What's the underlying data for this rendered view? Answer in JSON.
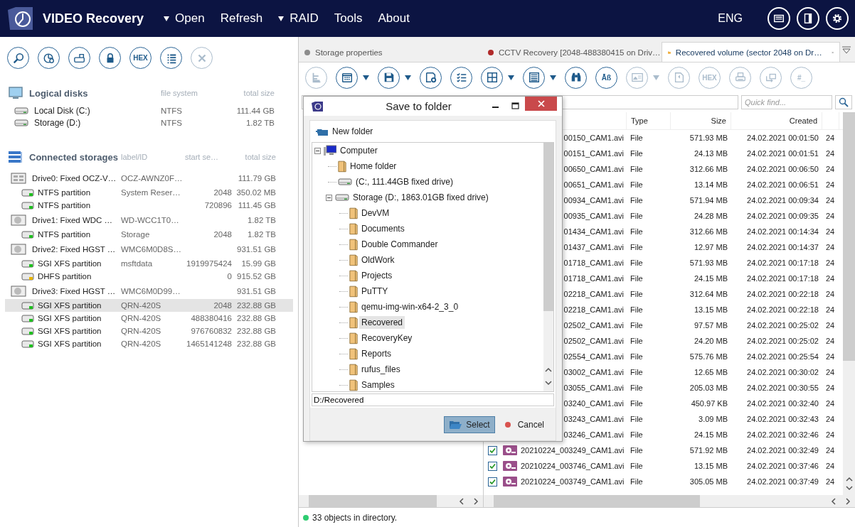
{
  "app": {
    "title": "VIDEO Recovery"
  },
  "menu": [
    {
      "label": "Open",
      "dropdown": true
    },
    {
      "label": "Refresh",
      "dropdown": false
    },
    {
      "label": "RAID",
      "dropdown": true
    },
    {
      "label": "Tools",
      "dropdown": false
    },
    {
      "label": "About",
      "dropdown": false
    }
  ],
  "language": "ENG",
  "header_buttons": [
    {
      "kind": "window"
    },
    {
      "kind": "sidebar"
    },
    {
      "kind": "settings"
    }
  ],
  "left_toolbar": [
    {
      "kind": "search",
      "disabled": false
    },
    {
      "kind": "pie",
      "disabled": false
    },
    {
      "kind": "image",
      "disabled": false
    },
    {
      "kind": "lock",
      "disabled": false
    },
    {
      "kind": "text",
      "label": "HEX",
      "disabled": false
    },
    {
      "kind": "list",
      "disabled": false
    },
    {
      "kind": "close",
      "disabled": true
    }
  ],
  "logical_disks": {
    "title": "Logical disks",
    "columns": [
      "file system",
      "total size"
    ],
    "rows": [
      {
        "name": "Local Disk (C:)",
        "file_system": "NTFS",
        "size": "111.44 GB"
      },
      {
        "name": "Storage (D:)",
        "file_system": "NTFS",
        "size": "1.82 TB"
      }
    ]
  },
  "connected_storages": {
    "title": "Connected storages",
    "columns": [
      "label/ID",
      "start se…",
      "total size"
    ],
    "drives": [
      {
        "name": "Drive0: Fixed OCZ-V…",
        "label": "OCZ-AWNZ0F…",
        "size": "111.79 GB",
        "kind": "ssd",
        "partitions": [
          {
            "name": "NTFS partition",
            "label": "System Reser…",
            "start": "2048",
            "size": "350.02 MB",
            "color": "#1fbf1f",
            "selected": false
          },
          {
            "name": "NTFS partition",
            "start": "720896",
            "size": "111.45 GB",
            "color": "#1fbf1f",
            "selected": false
          }
        ]
      },
      {
        "name": "Drive1: Fixed WDC …",
        "label": "WD-WCC1T0…",
        "size": "1.82 TB",
        "kind": "hdd",
        "partitions": [
          {
            "name": "NTFS partition",
            "label": "Storage",
            "start": "2048",
            "size": "1.82 TB",
            "color": "#1fbf1f",
            "selected": false
          }
        ]
      },
      {
        "name": "Drive2: Fixed HGST …",
        "label": "WMC6M0D8S…",
        "size": "931.51 GB",
        "kind": "hdd",
        "partitions": [
          {
            "name": "SGI XFS partition",
            "label": "msftdata",
            "start": "1919975424",
            "size": "15.99 GB",
            "color": "#1fbf1f",
            "selected": false
          },
          {
            "name": "DHFS partition",
            "start": "0",
            "size": "915.52 GB",
            "color": "#e8b400",
            "selected": false
          }
        ]
      },
      {
        "name": "Drive3: Fixed HGST …",
        "label": "WMC6M0D99…",
        "size": "931.51 GB",
        "kind": "hdd",
        "partitions": [
          {
            "name": "SGI XFS partition",
            "label": "QRN-420S",
            "start": "2048",
            "size": "232.88 GB",
            "color": "#1fbf1f",
            "selected": true
          },
          {
            "name": "SGI XFS partition",
            "label": "QRN-420S",
            "start": "488380416",
            "size": "232.88 GB",
            "color": "#1fbf1f",
            "selected": false
          },
          {
            "name": "SGI XFS partition",
            "label": "QRN-420S",
            "start": "976760832",
            "size": "232.88 GB",
            "color": "#1fbf1f",
            "selected": false
          },
          {
            "name": "SGI XFS partition",
            "label": "QRN-420S",
            "start": "1465141248",
            "size": "232.88 GB",
            "color": "#1fbf1f",
            "selected": false
          }
        ]
      }
    ]
  },
  "tabs": [
    {
      "label": "Storage properties",
      "kind": "dot",
      "color": "#8c8c8c",
      "selected": false
    },
    {
      "label": "CCTV Recovery [2048-488380415 on Driv…",
      "kind": "dot",
      "color": "#b02a2a",
      "selected": false
    },
    {
      "label": "Recovered volume (sector 2048 on Dr…",
      "kind": "folder",
      "selected": true
    }
  ],
  "toolbar": [
    {
      "kind": "tree",
      "disabled": true
    },
    {
      "kind": "calendar",
      "disabled": false,
      "dropdown": true
    },
    {
      "kind": "save",
      "disabled": false,
      "dropdown": true
    },
    {
      "kind": "saveconfig",
      "disabled": false
    },
    {
      "kind": "checklist",
      "disabled": false
    },
    {
      "kind": "grid",
      "disabled": false,
      "dropdown": true
    },
    {
      "kind": "panel",
      "disabled": false,
      "dropdown": true
    },
    {
      "kind": "binoculars",
      "disabled": false
    },
    {
      "kind": "text",
      "label": "Āß",
      "disabled": false
    },
    {
      "kind": "picture",
      "disabled": true,
      "dropdown": true
    },
    {
      "kind": "export",
      "disabled": true
    },
    {
      "kind": "text",
      "label": "HEX",
      "disabled": true
    },
    {
      "kind": "print",
      "disabled": true
    },
    {
      "kind": "transfer",
      "disabled": true
    },
    {
      "kind": "text",
      "label": "#_",
      "disabled": true
    }
  ],
  "quick_find": {
    "placeholder": "Quick find..."
  },
  "table": {
    "columns": {
      "type": "Type",
      "size": "Size",
      "created": "Created"
    },
    "rows": [
      {
        "kind": "partial",
        "name": "00150_CAM1.avi",
        "type": "File",
        "size": "571.93 MB",
        "created": "24.02.2021 00:01:50",
        "column_5": "24"
      },
      {
        "kind": "partial",
        "name": "00151_CAM1.avi",
        "type": "File",
        "size": "24.13 MB",
        "created": "24.02.2021 00:01:51",
        "column_5": "24"
      },
      {
        "kind": "partial",
        "name": "00650_CAM1.avi",
        "type": "File",
        "size": "312.66 MB",
        "created": "24.02.2021 00:06:50",
        "column_5": "24"
      },
      {
        "kind": "partial",
        "name": "00651_CAM1.avi",
        "type": "File",
        "size": "13.14 MB",
        "created": "24.02.2021 00:06:51",
        "column_5": "24"
      },
      {
        "kind": "partial",
        "name": "00934_CAM1.avi",
        "type": "File",
        "size": "571.94 MB",
        "created": "24.02.2021 00:09:34",
        "column_5": "24"
      },
      {
        "kind": "partial",
        "name": "00935_CAM1.avi",
        "type": "File",
        "size": "24.28 MB",
        "created": "24.02.2021 00:09:35",
        "column_5": "24"
      },
      {
        "kind": "partial",
        "name": "01434_CAM1.avi",
        "type": "File",
        "size": "312.66 MB",
        "created": "24.02.2021 00:14:34",
        "column_5": "24"
      },
      {
        "kind": "partial",
        "name": "01437_CAM1.avi",
        "type": "File",
        "size": "12.97 MB",
        "created": "24.02.2021 00:14:37",
        "column_5": "24"
      },
      {
        "kind": "partial",
        "name": "01718_CAM1.avi",
        "type": "File",
        "size": "571.93 MB",
        "created": "24.02.2021 00:17:18",
        "column_5": "24"
      },
      {
        "kind": "partial",
        "name": "01718_CAM1.avi",
        "type": "File",
        "size": "24.15 MB",
        "created": "24.02.2021 00:17:18",
        "column_5": "24"
      },
      {
        "kind": "partial",
        "name": "02218_CAM1.avi",
        "type": "File",
        "size": "312.64 MB",
        "created": "24.02.2021 00:22:18",
        "column_5": "24"
      },
      {
        "kind": "partial",
        "name": "02218_CAM1.avi",
        "type": "File",
        "size": "13.15 MB",
        "created": "24.02.2021 00:22:18",
        "column_5": "24"
      },
      {
        "kind": "partial",
        "name": "02502_CAM1.avi",
        "type": "File",
        "size": "97.57 MB",
        "created": "24.02.2021 00:25:02",
        "column_5": "24"
      },
      {
        "kind": "partial",
        "name": "02502_CAM1.avi",
        "type": "File",
        "size": "24.20 MB",
        "created": "24.02.2021 00:25:02",
        "column_5": "24"
      },
      {
        "kind": "partial",
        "name": "02554_CAM1.avi",
        "type": "File",
        "size": "575.76 MB",
        "created": "24.02.2021 00:25:54",
        "column_5": "24"
      },
      {
        "kind": "partial",
        "name": "03002_CAM1.avi",
        "type": "File",
        "size": "12.65 MB",
        "created": "24.02.2021 00:30:02",
        "column_5": "24"
      },
      {
        "kind": "partial",
        "name": "03055_CAM1.avi",
        "type": "File",
        "size": "205.03 MB",
        "created": "24.02.2021 00:30:55",
        "column_5": "24"
      },
      {
        "kind": "partial",
        "name": "03240_CAM1.avi",
        "type": "File",
        "size": "450.97 KB",
        "created": "24.02.2021 00:32:40",
        "column_5": "24"
      },
      {
        "kind": "partial",
        "name": "03243_CAM1.avi",
        "type": "File",
        "size": "3.09 MB",
        "created": "24.02.2021 00:32:43",
        "column_5": "24"
      },
      {
        "kind": "partial",
        "name": "03246_CAM1.avi",
        "type": "File",
        "size": "24.15 MB",
        "created": "24.02.2021 00:32:46",
        "column_5": "24"
      },
      {
        "kind": "full",
        "checked": true,
        "name": "20210224_003249_CAM1.avi",
        "type": "File",
        "size": "571.92 MB",
        "created": "24.02.2021 00:32:49",
        "column_5": "24"
      },
      {
        "kind": "full",
        "checked": true,
        "name": "20210224_003746_CAM1.avi",
        "type": "File",
        "size": "13.15 MB",
        "created": "24.02.2021 00:37:46",
        "column_5": "24"
      },
      {
        "kind": "full",
        "checked": true,
        "name": "20210224_003749_CAM1.avi",
        "type": "File",
        "size": "305.05 MB",
        "created": "24.02.2021 00:37:49",
        "column_5": "24"
      }
    ]
  },
  "status_bar": {
    "text": "33 objects in directory.",
    "color": "#2ecc71"
  },
  "dialog": {
    "title": "Save to folder",
    "new_folder": "New folder",
    "tree": [
      {
        "label": "Computer",
        "kind": "computer",
        "expanded": true,
        "selected": false,
        "children": [
          {
            "label": "Home folder",
            "kind": "folder",
            "selected": false
          },
          {
            "label": "(C:, 111.44GB fixed drive)",
            "kind": "drive",
            "selected": false
          },
          {
            "label": "Storage (D:, 1863.01GB fixed drive)",
            "kind": "drive",
            "expanded": true,
            "selected": false,
            "children": [
              {
                "label": "DevVM",
                "kind": "folder",
                "selected": false
              },
              {
                "label": "Documents",
                "kind": "folder",
                "selected": false
              },
              {
                "label": "Double Commander",
                "kind": "folder",
                "selected": false
              },
              {
                "label": "OldWork",
                "kind": "folder",
                "selected": false
              },
              {
                "label": "Projects",
                "kind": "folder",
                "selected": false
              },
              {
                "label": "PuTTY",
                "kind": "folder",
                "selected": false
              },
              {
                "label": "qemu-img-win-x64-2_3_0",
                "kind": "folder",
                "selected": false
              },
              {
                "label": "Recovered",
                "kind": "folder",
                "selected": true
              },
              {
                "label": "RecoveryKey",
                "kind": "folder",
                "selected": false
              },
              {
                "label": "Reports",
                "kind": "folder",
                "selected": false
              },
              {
                "label": "rufus_files",
                "kind": "folder",
                "selected": false
              },
              {
                "label": "Samples",
                "kind": "folder",
                "selected": false
              }
            ]
          }
        ]
      }
    ],
    "path": "D:/Recovered",
    "buttons": [
      {
        "label": "Select",
        "kind": "primary"
      },
      {
        "label": "Cancel",
        "kind": "cancel"
      }
    ]
  }
}
